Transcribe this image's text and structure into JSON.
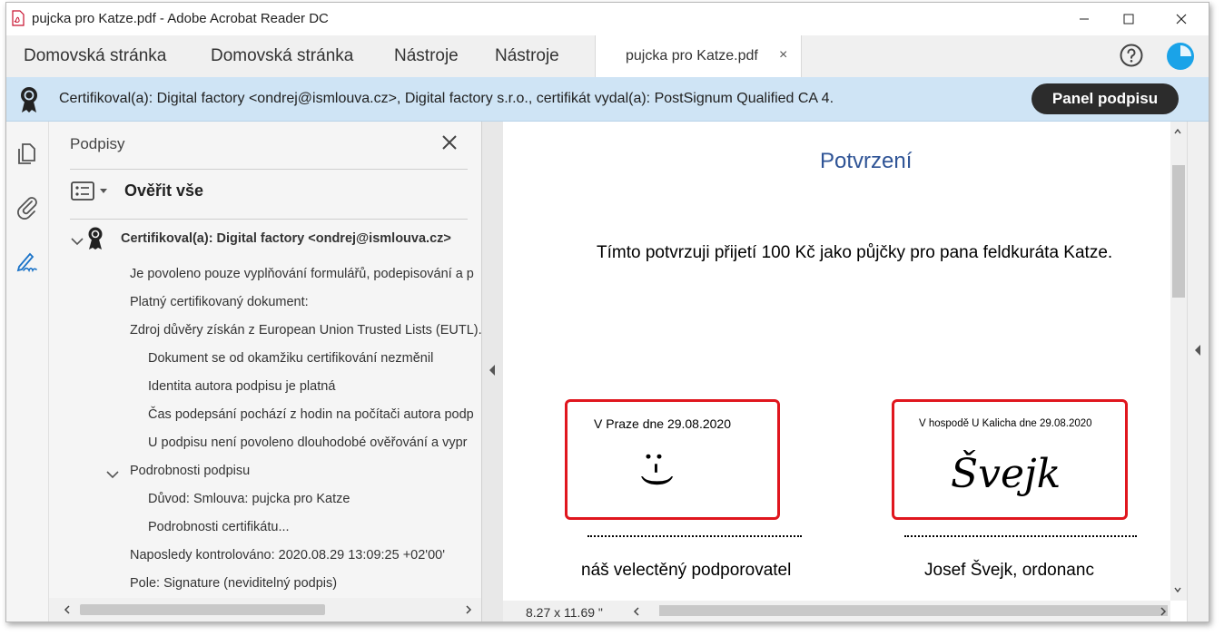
{
  "window": {
    "title": "pujcka pro Katze.pdf - Adobe Acrobat Reader DC"
  },
  "tabs": {
    "home1": "Domovská stránka",
    "home2": "Domovská stránka",
    "tools1": "Nástroje",
    "tools2": "Nástroje",
    "document": "pujcka pro Katze.pdf",
    "document_close": "×"
  },
  "certbar": {
    "text": "Certifikoval(a): Digital factory <ondrej@ismlouva.cz>, Digital factory s.r.o., certifikát vydal(a): PostSignum Qualified CA 4.",
    "button": "Panel podpisu"
  },
  "signatures_panel": {
    "title": "Podpisy",
    "verify_all": "Ověřit vše",
    "signature": {
      "label": "Certifikoval(a): Digital factory <ondrej@ismlouva.cz>",
      "items": [
        "Je povoleno pouze vyplňování formulářů, podepisování a p",
        "Platný certifikovaný dokument:",
        "Zdroj důvěry získán z European Union Trusted Lists (EUTL)."
      ],
      "validity": [
        "Dokument se od okamžiku certifikování nezměnil",
        "Identita autora podpisu je platná",
        "Čas podepsání pochází z hodin na počítači autora podp",
        "U podpisu není povoleno dlouhodobé ověřování a vypr"
      ],
      "details_label": "Podrobnosti podpisu",
      "details": [
        "Důvod: Smlouva: pujcka pro Katze",
        "Podrobnosti certifikátu..."
      ],
      "last_checked": "Naposledy kontrolováno: 2020.08.29 13:09:25 +02'00'",
      "field": "Pole: Signature (neviditelný podpis)"
    }
  },
  "document": {
    "title": "Potvrzení",
    "body": "Tímto potvrzuji přijetí 100 Kč jako půjčky pro pana feldkuráta Katze.",
    "left_signature": {
      "place": "V Praze dne 29.08.2020",
      "mark": ":-)",
      "caption": "náš velectěný podporovatel"
    },
    "right_signature": {
      "place": "V hospodě U Kalicha dne 29.08.2020",
      "mark": "Švejk",
      "caption": "Josef Švejk, ordonanc"
    }
  },
  "status": {
    "page_size": "8.27 x 11.69 \""
  },
  "colors": {
    "accent": "#1aa3e8",
    "certbar_bg": "#cfe4f5",
    "highlight_red": "#e0161e",
    "title_blue": "#2f5496"
  }
}
